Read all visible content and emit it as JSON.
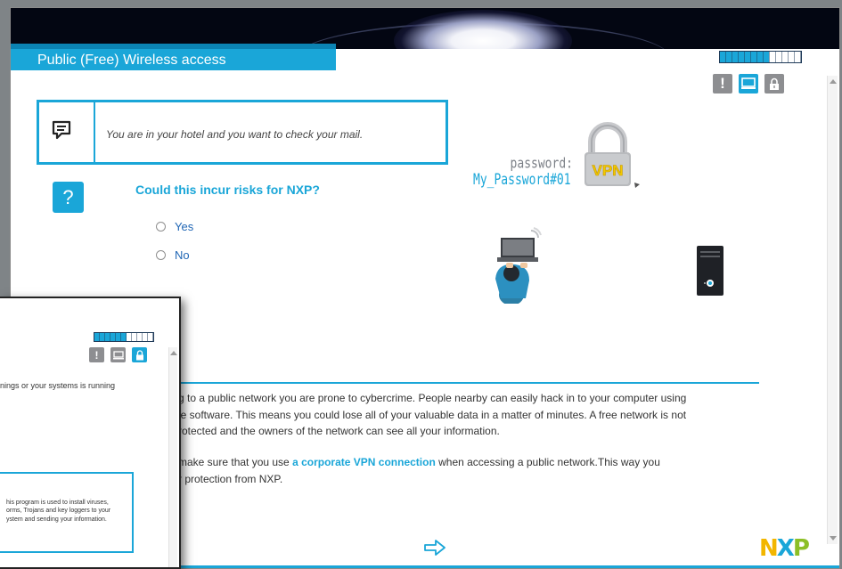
{
  "header": {
    "title": "Public (Free) Wireless access",
    "progress_fraction": 0.6
  },
  "status_icons": {
    "warning": "!",
    "screen": "monitor-icon",
    "lock": "lock-icon"
  },
  "scenario": {
    "text": "You are in your hotel and you want to check your mail."
  },
  "question": {
    "icon": "?",
    "text": "Could this incur risks for NXP?",
    "options": [
      {
        "label": "Yes",
        "selected": false
      },
      {
        "label": "No",
        "selected": false
      }
    ]
  },
  "illustration": {
    "password_label": "password:",
    "password_value": "My_Password#01",
    "vpn_label": "VPN"
  },
  "info": {
    "para1_lines": [
      "g to a public network you are prone to cybercrime. People nearby can easily hack in to your computer using",
      "le software. This means you could lose all of your valuable data in a matter of minutes. A free network is not",
      "rotected and the owners of the network can see all your information."
    ],
    "para2_before": "make sure that you use ",
    "para2_link": "a corporate VPN connection",
    "para2_after": " when accessing a public network.This way you",
    "para2_line2": "r protection from NXP."
  },
  "footer": {
    "logo_n": "N",
    "logo_x": "X",
    "logo_p": "P"
  },
  "overlay": {
    "progress_fraction": 0.55,
    "warning": "!",
    "text1": "nings or your systems is running",
    "box_lines": [
      "his program is used to install viruses,",
      "orms, Trojans and key loggers to your",
      "ystem and sending your information."
    ]
  },
  "colors": {
    "accent": "#1aa6d8",
    "dark": "#030612",
    "link_blue": "#2167b5",
    "logo_yellow": "#f2b600",
    "logo_blue": "#1aa6d8",
    "logo_green": "#8cbf26"
  }
}
